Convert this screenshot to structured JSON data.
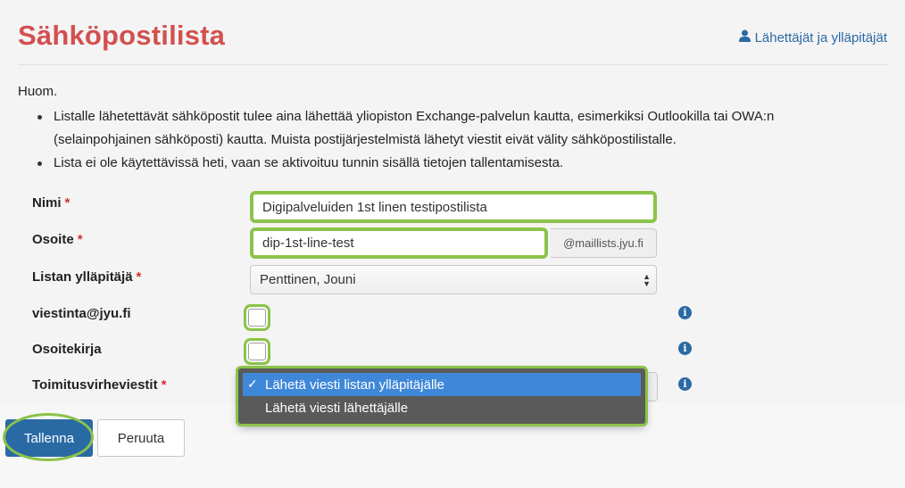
{
  "header": {
    "title": "Sähköpostilista",
    "senders_link": "Lähettäjät ja ylläpitäjät"
  },
  "notice": {
    "heading": "Huom.",
    "items": [
      "Listalle lähetettävät sähköpostit tulee aina lähettää yliopiston Exchange-palvelun kautta, esimerkiksi Outlookilla tai OWA:n (selainpohjainen sähköposti) kautta. Muista postijärjestelmistä lähetyt viestit eivät välity sähköpostilistalle.",
      "Lista ei ole käytettävissä heti, vaan se aktivoituu tunnin sisällä tietojen tallentamisesta."
    ]
  },
  "form": {
    "required_marker": "*",
    "name": {
      "label": "Nimi",
      "value": "Digipalveluiden 1st linen testipostilista"
    },
    "address": {
      "label": "Osoite",
      "value": "dip-1st-line-test",
      "domain": "@maillists.jyu.fi"
    },
    "admin": {
      "label": "Listan ylläpitäjä",
      "value": "Penttinen, Jouni"
    },
    "viestinta": {
      "label": "viestinta@jyu.fi",
      "checked": false
    },
    "addressbook": {
      "label": "Osoitekirja",
      "checked": false
    },
    "bounce": {
      "label": "Toimitusvirheviestit",
      "options": [
        "Lähetä viesti listan ylläpitäjälle",
        "Lähetä viesti lähettäjälle"
      ],
      "selected_index": 0
    }
  },
  "buttons": {
    "save": "Tallenna",
    "cancel": "Peruuta"
  },
  "colors": {
    "title": "#d2504f",
    "link": "#2a6aa4",
    "highlight": "#8bc34a",
    "dropdown_selected": "#3f88d9"
  }
}
